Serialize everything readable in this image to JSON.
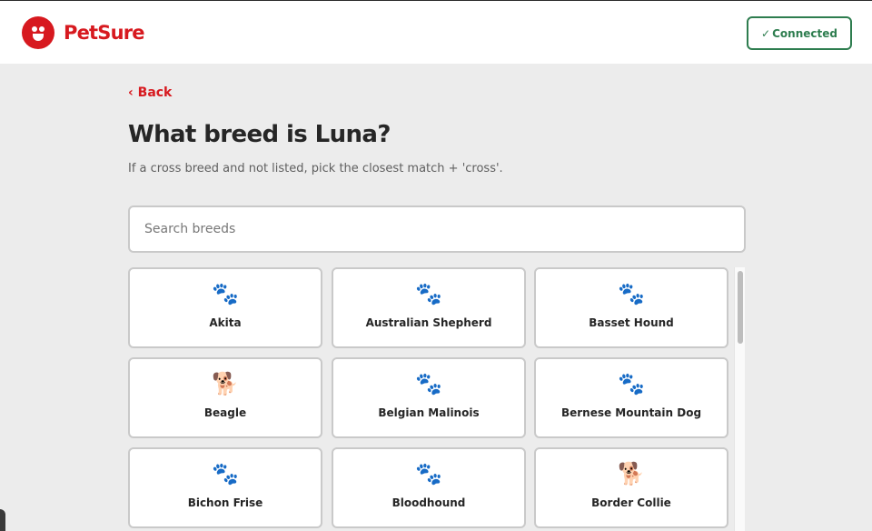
{
  "header": {
    "brand": "PetSure",
    "status_check": "✓",
    "status_label": "Connected"
  },
  "nav": {
    "back_label": "‹ Back"
  },
  "page": {
    "title": "What breed is Luna?",
    "subtitle": "If a cross breed and not listed, pick the closest match + 'cross'."
  },
  "search": {
    "placeholder": "Search breeds",
    "value": ""
  },
  "breeds": [
    {
      "name": "Akita",
      "icon": "🐾",
      "icon_name": "paw-icon"
    },
    {
      "name": "Australian Shepherd",
      "icon": "🐾",
      "icon_name": "paw-icon"
    },
    {
      "name": "Basset Hound",
      "icon": "🐾",
      "icon_name": "paw-icon"
    },
    {
      "name": "Beagle",
      "icon": "🐕",
      "icon_name": "dog-icon"
    },
    {
      "name": "Belgian Malinois",
      "icon": "🐾",
      "icon_name": "paw-icon"
    },
    {
      "name": "Bernese Mountain Dog",
      "icon": "🐾",
      "icon_name": "paw-icon"
    },
    {
      "name": "Bichon Frise",
      "icon": "🐾",
      "icon_name": "paw-icon"
    },
    {
      "name": "Bloodhound",
      "icon": "🐾",
      "icon_name": "paw-icon"
    },
    {
      "name": "Border Collie",
      "icon": "🐕",
      "icon_name": "dog-icon"
    },
    {
      "name": "",
      "icon": "",
      "icon_name": ""
    },
    {
      "name": "",
      "icon": "",
      "icon_name": ""
    },
    {
      "name": "",
      "icon": "",
      "icon_name": ""
    }
  ],
  "colors": {
    "brand": "#d7191f",
    "connected": "#2e7d4f",
    "background": "#ececec"
  }
}
